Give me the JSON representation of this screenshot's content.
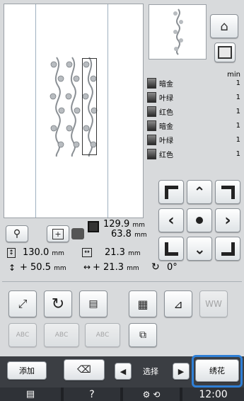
{
  "threads": {
    "header": "min",
    "items": [
      {
        "name": "暗金",
        "count": "1"
      },
      {
        "name": "叶绿",
        "count": "1"
      },
      {
        "name": "红色",
        "count": "1"
      },
      {
        "name": "暗金",
        "count": "1"
      },
      {
        "name": "叶绿",
        "count": "1"
      },
      {
        "name": "红色",
        "count": "1"
      }
    ]
  },
  "size": {
    "height_value": "129.9",
    "height_unit": "mm",
    "width_value": "63.8",
    "width_unit": "mm"
  },
  "position": {
    "row1_v": "130.0",
    "row1_v_unit": "mm",
    "row1_h": "21.3",
    "row1_h_unit": "mm",
    "row2_v": "+ 50.5",
    "row2_v_unit": "mm",
    "row2_h": "+ 21.3",
    "row2_h_unit": "mm",
    "angle": "0°"
  },
  "bottom": {
    "add_label": "添加",
    "select_label": "选择",
    "embroider_label": "绣花"
  },
  "taskbar": {
    "help": "?",
    "time": "12:00"
  },
  "colors": {
    "highlight": "#2f7fd6",
    "bottom_bar": "#3b3e43"
  }
}
